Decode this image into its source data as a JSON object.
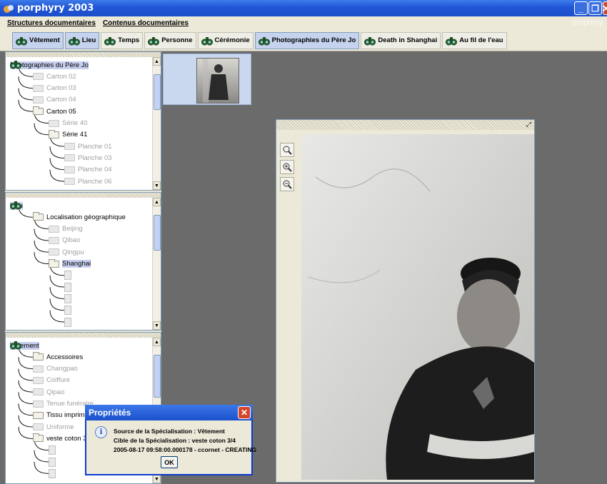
{
  "window": {
    "title": "porphyry 2003",
    "watermark": "porphyry"
  },
  "menu": [
    "Structures documentaires",
    "Contenus documentaires"
  ],
  "toolbar": [
    {
      "label": "Vêtement",
      "active": true
    },
    {
      "label": "Lieu",
      "active": true
    },
    {
      "label": "Temps",
      "active": false
    },
    {
      "label": "Personne",
      "active": false
    },
    {
      "label": "Cérémonie",
      "active": false
    },
    {
      "label": "Photographies du Père Jo",
      "active": true
    },
    {
      "label": "Death in Shanghai",
      "active": false
    },
    {
      "label": "Au fil de l'eau",
      "active": false
    }
  ],
  "panels": [
    {
      "root": "Photographies du Père Jo",
      "nodes": [
        {
          "label": "Carton 02",
          "depth": 1,
          "type": "folder",
          "disabled": true
        },
        {
          "label": "Carton 03",
          "depth": 1,
          "type": "folder",
          "disabled": true
        },
        {
          "label": "Carton 04",
          "depth": 1,
          "type": "folder",
          "disabled": true
        },
        {
          "label": "Carton 05",
          "depth": 1,
          "type": "folder-open",
          "disabled": false
        },
        {
          "label": "Série 40",
          "depth": 2,
          "type": "folder",
          "disabled": true
        },
        {
          "label": "Série 41",
          "depth": 2,
          "type": "folder-open",
          "disabled": false
        },
        {
          "label": "Planche 01",
          "depth": 3,
          "type": "folder",
          "disabled": true
        },
        {
          "label": "Planche 03",
          "depth": 3,
          "type": "folder",
          "disabled": true
        },
        {
          "label": "Planche 04",
          "depth": 3,
          "type": "folder",
          "disabled": true
        },
        {
          "label": "Planche 06",
          "depth": 3,
          "type": "folder",
          "disabled": true
        }
      ]
    },
    {
      "root": "Lieu",
      "nodes": [
        {
          "label": "Localisation géographique",
          "depth": 1,
          "type": "folder-open",
          "disabled": false
        },
        {
          "label": "Beijing",
          "depth": 2,
          "type": "folder",
          "disabled": true
        },
        {
          "label": "Qibao",
          "depth": 2,
          "type": "folder",
          "disabled": true
        },
        {
          "label": "Qingpu",
          "depth": 2,
          "type": "folder",
          "disabled": true
        },
        {
          "label": "Shanghai",
          "depth": 2,
          "type": "folder-open",
          "disabled": false,
          "selected": true
        },
        {
          "label": "",
          "depth": 3,
          "type": "doc"
        },
        {
          "label": "",
          "depth": 3,
          "type": "doc"
        },
        {
          "label": "",
          "depth": 3,
          "type": "doc"
        },
        {
          "label": "",
          "depth": 3,
          "type": "doc"
        },
        {
          "label": "",
          "depth": 3,
          "type": "doc"
        }
      ]
    },
    {
      "root": "Vêtement",
      "nodes": [
        {
          "label": "Accessoires",
          "depth": 1,
          "type": "folder-open",
          "disabled": false
        },
        {
          "label": "Changpao",
          "depth": 1,
          "type": "folder",
          "disabled": true
        },
        {
          "label": "Coiffure",
          "depth": 1,
          "type": "folder",
          "disabled": true
        },
        {
          "label": "Qipao",
          "depth": 1,
          "type": "folder",
          "disabled": true
        },
        {
          "label": "Tenue funéraire",
          "depth": 1,
          "type": "folder",
          "disabled": true
        },
        {
          "label": "Tissu imprimé",
          "depth": 1,
          "type": "folder",
          "disabled": false
        },
        {
          "label": "Uniforme",
          "depth": 1,
          "type": "folder",
          "disabled": true
        },
        {
          "label": "veste coton 3/4",
          "depth": 1,
          "type": "folder-open",
          "disabled": false
        },
        {
          "label": "",
          "depth": 2,
          "type": "doc"
        },
        {
          "label": "",
          "depth": 2,
          "type": "doc"
        },
        {
          "label": "",
          "depth": 2,
          "type": "doc"
        }
      ]
    }
  ],
  "dialog": {
    "title": "Propriétés",
    "lines": [
      "Source de la Spécialisation : Vêtement",
      "Cible  de la Spécialisation : veste coton 3/4",
      "2005-08-17 09:58:00.000178 - ccornet - CREATING"
    ],
    "ok": "OK"
  },
  "icons": {
    "zoom": [
      "zoom-fit-icon",
      "zoom-in-icon",
      "zoom-out-icon"
    ]
  }
}
